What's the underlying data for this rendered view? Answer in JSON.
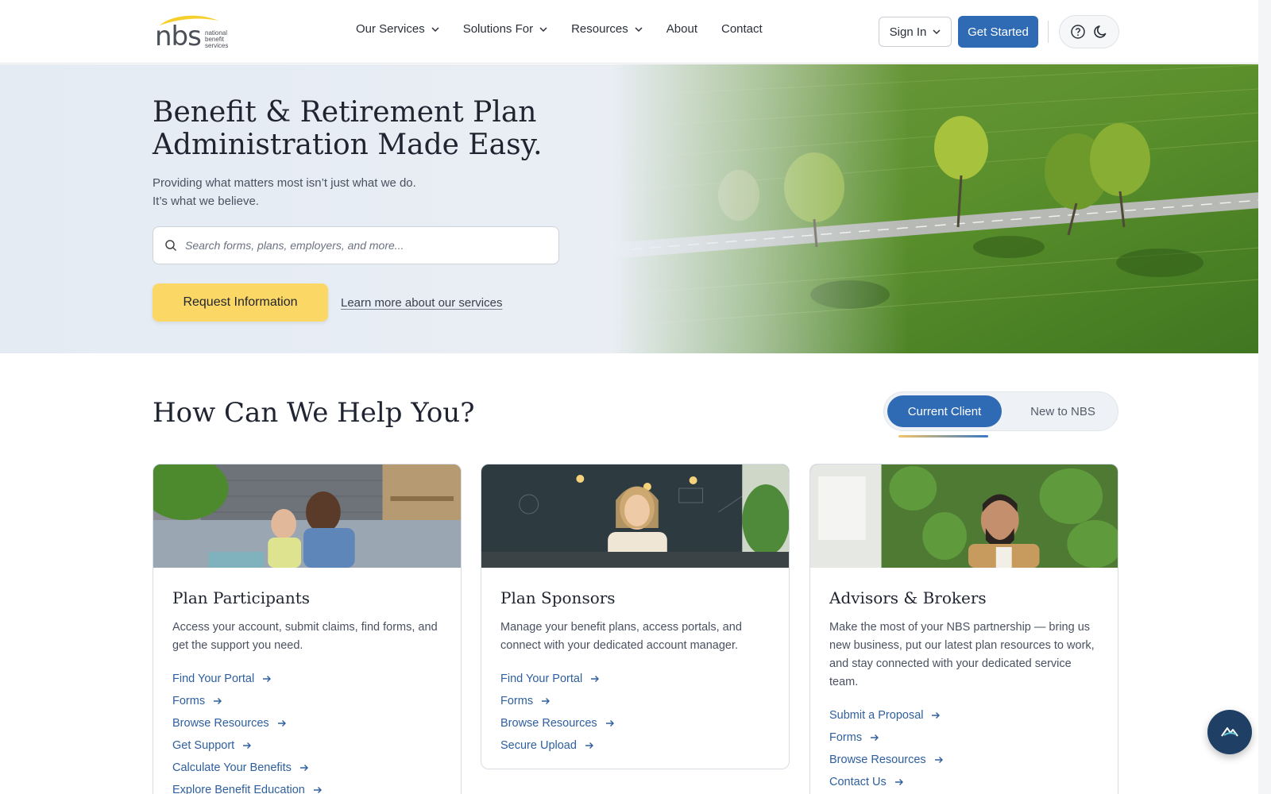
{
  "logo": {
    "letters": "nbs",
    "tagline": [
      "national",
      "benefit",
      "services"
    ]
  },
  "nav": {
    "items": [
      {
        "label": "Our Services",
        "dropdown": true
      },
      {
        "label": "Solutions For",
        "dropdown": true
      },
      {
        "label": "Resources",
        "dropdown": true
      },
      {
        "label": "About",
        "dropdown": false
      },
      {
        "label": "Contact",
        "dropdown": false
      }
    ],
    "sign_in": "Sign In",
    "get_started": "Get Started"
  },
  "hero": {
    "title": "Benefit & Retirement Plan Administration Made Easy.",
    "subtitle_line1": "Providing what matters most isn’t just what we do.",
    "subtitle_line2": "It’s what we believe.",
    "search_placeholder": "Search forms, plans, employers, and more...",
    "cta_primary": "Request Information",
    "cta_link": "Learn more about our services"
  },
  "help": {
    "title": "How Can We Help You?",
    "toggle_active": "Current Client",
    "toggle_inactive": "New to NBS"
  },
  "cards": [
    {
      "title": "Plan Participants",
      "description": "Access your account, submit claims, find forms, and get the support you need.",
      "links": [
        "Find Your Portal",
        "Forms",
        "Browse Resources",
        "Get Support",
        "Calculate Your Benefits",
        "Explore Benefit Education"
      ]
    },
    {
      "title": "Plan Sponsors",
      "description": "Manage your benefit plans, access portals, and connect with your dedicated account manager.",
      "links": [
        "Find Your Portal",
        "Forms",
        "Browse Resources",
        "Secure Upload"
      ]
    },
    {
      "title": "Advisors & Brokers",
      "description": "Make the most of your NBS partnership — bring us new business, put our latest plan resources to work, and stay connected with your dedicated service team.",
      "links": [
        "Submit a Proposal",
        "Forms",
        "Browse Resources",
        "Contact Us"
      ]
    }
  ],
  "colors": {
    "primary": "#2f6ab4",
    "accent_yellow": "#fbd865",
    "link": "#2e5f9e",
    "fab": "#1f3f64"
  }
}
